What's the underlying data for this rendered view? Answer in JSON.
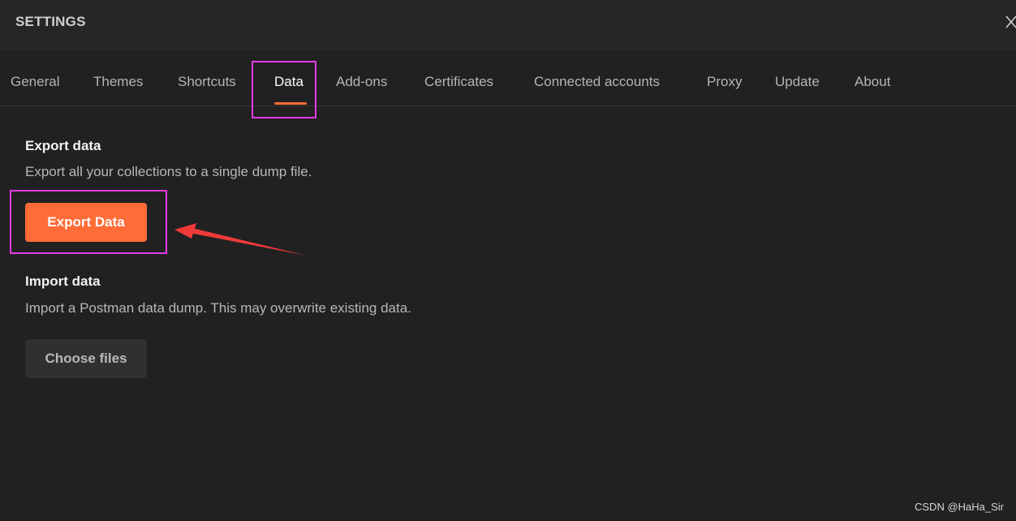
{
  "window": {
    "title": "SETTINGS",
    "close_icon": "close-icon"
  },
  "tabs": [
    {
      "label": "General"
    },
    {
      "label": "Themes"
    },
    {
      "label": "Shortcuts"
    },
    {
      "label": "Data",
      "active": true
    },
    {
      "label": "Add-ons"
    },
    {
      "label": "Certificates"
    },
    {
      "label": "Connected accounts"
    },
    {
      "label": "Proxy"
    },
    {
      "label": "Update"
    },
    {
      "label": "About"
    }
  ],
  "export": {
    "heading": "Export data",
    "description": "Export all your collections to a single dump file.",
    "button_label": "Export Data"
  },
  "import": {
    "heading": "Import data",
    "description": "Import a Postman data dump. This may overwrite existing data.",
    "button_label": "Choose files"
  },
  "watermark": "CSDN @HaHa_Sir",
  "colors": {
    "background": "#212121",
    "header": "#262626",
    "accent": "#ff6c37",
    "highlight_box": "#e23be3",
    "annotation_arrow": "#f03a3a"
  }
}
